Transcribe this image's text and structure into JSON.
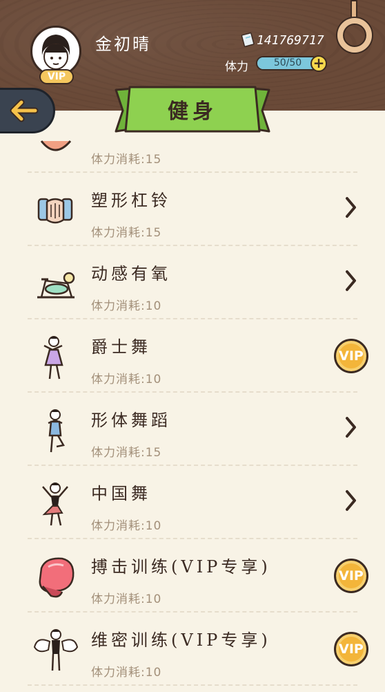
{
  "header": {
    "username": "金初晴",
    "vip_badge": "VIP",
    "money": "141769717",
    "stamina_label": "体力",
    "stamina_text": "50/50",
    "stamina_fraction": 1.0,
    "plus": "+"
  },
  "banner": {
    "title": "健身"
  },
  "list": {
    "partial_item": {
      "cost": "体力消耗:15"
    },
    "items": [
      {
        "name": "塑形杠铃",
        "cost": "体力消耗:15",
        "icon": "dumbbell-icon",
        "action": "chevron"
      },
      {
        "name": "动感有氧",
        "cost": "体力消耗:10",
        "icon": "exercise-bike-icon",
        "action": "chevron"
      },
      {
        "name": "爵士舞",
        "cost": "体力消耗:10",
        "icon": "jazz-dancer-icon",
        "action": "vip",
        "vip_label": "VIP"
      },
      {
        "name": "形体舞蹈",
        "cost": "体力消耗:15",
        "icon": "posture-dancer-icon",
        "action": "chevron"
      },
      {
        "name": "中国舞",
        "cost": "体力消耗:10",
        "icon": "chinese-dancer-icon",
        "action": "chevron"
      },
      {
        "name": "搏击训练(VIP专享)",
        "cost": "体力消耗:10",
        "icon": "boxing-glove-icon",
        "action": "vip",
        "vip_label": "VIP"
      },
      {
        "name": "维密训练(VIP专享)",
        "cost": "体力消耗:10",
        "icon": "angel-wings-icon",
        "action": "vip",
        "vip_label": "VIP"
      }
    ]
  },
  "colors": {
    "header_wood": "#6a4a38",
    "banner_green": "#8ed150",
    "background": "#f8f3e6",
    "vip_gold": "#f3b53a",
    "stamina_blue": "#7cc7dc"
  }
}
